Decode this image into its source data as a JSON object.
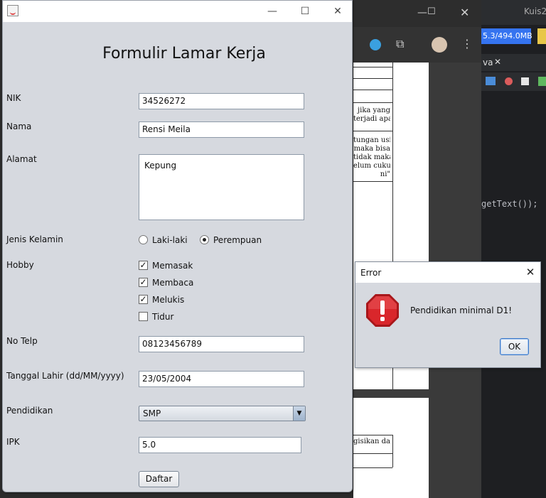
{
  "background": {
    "browser_doc_lines": [
      "jika   yang",
      "terjadi apa-",
      "tungan usia,",
      "maka   bisa",
      "tidak maka",
      "elum cukup",
      "ni\"",
      "gisikan data"
    ],
    "ide": {
      "title": "Kuis2",
      "memory": "5.3/494.0MB",
      "tab": "va",
      "code": "getText());"
    }
  },
  "window": {
    "title": "",
    "minimize": "—",
    "maximize": "☐",
    "close": "✕"
  },
  "form": {
    "title": "Formulir Lamar Kerja",
    "nik": {
      "label": "NIK",
      "value": "34526272"
    },
    "nama": {
      "label": "Nama",
      "value": "Rensi Meila"
    },
    "alamat": {
      "label": "Alamat",
      "value": "Kepung"
    },
    "jenis_kelamin": {
      "label": "Jenis Kelamin",
      "options": [
        "Laki-laki",
        "Perempuan"
      ],
      "selected": "Perempuan"
    },
    "hobby": {
      "label": "Hobby",
      "items": [
        {
          "label": "Memasak",
          "checked": true
        },
        {
          "label": "Membaca",
          "checked": true
        },
        {
          "label": "Melukis",
          "checked": true
        },
        {
          "label": "Tidur",
          "checked": false
        }
      ]
    },
    "no_telp": {
      "label": "No Telp",
      "value": "08123456789"
    },
    "tanggal_lahir": {
      "label": "Tanggal Lahir (dd/MM/yyyy)",
      "value": "23/05/2004"
    },
    "pendidikan": {
      "label": "Pendidikan",
      "value": "SMP"
    },
    "ipk": {
      "label": "IPK",
      "value": "5.0"
    },
    "submit": "Daftar"
  },
  "dialog": {
    "title": "Error",
    "close": "✕",
    "message": "Pendidikan minimal D1!",
    "ok": "OK",
    "icon": "error-stop-icon"
  }
}
